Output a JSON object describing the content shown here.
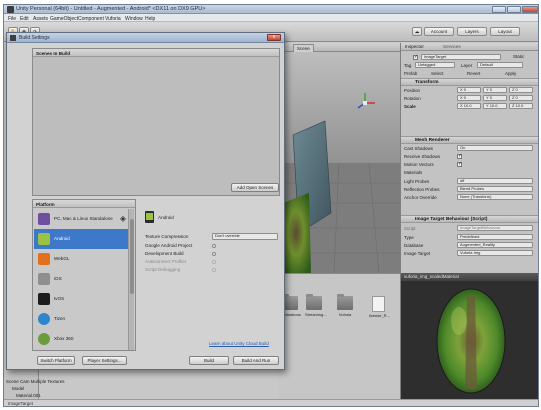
{
  "window": {
    "title": "Unity Personal (64bit) - Untitled - Augmented - Android* <DX11 on DX9 GPU>"
  },
  "menubar": [
    "File",
    "Edit",
    "Assets",
    "GameObject",
    "Component",
    "Vuforia",
    "Window",
    "Help"
  ],
  "toolbar": {
    "account_label": "Account",
    "layers_label": "Layers",
    "layout_label": "Layout"
  },
  "scene": {
    "tab_label": "Scene"
  },
  "inspector": {
    "tab_label": "Inspector",
    "services_label": "Services",
    "object_name": "ImageTarget",
    "static_label": "Static",
    "tag_label": "Tag",
    "tag_value": "Untagged",
    "layer_label": "Layer",
    "layer_value": "Default",
    "prefab_label": "Prefab",
    "select_label": "Select",
    "revert_label": "Revert",
    "apply_label": "Apply",
    "transform_title": "Transform",
    "position_label": "Position",
    "rotation_label": "Rotation",
    "scale_label": "Scale",
    "position_x": "X 0",
    "position_y": "Y 0",
    "position_z": "Z 0",
    "rotation_x": "X 0",
    "rotation_y": "Y 0",
    "rotation_z": "Z 0",
    "scale_x": "X 10.0",
    "scale_y": "Y 10.0",
    "scale_z": "Z 10.0",
    "mesh_renderer_title": "Mesh Renderer",
    "cast_shadows_label": "Cast Shadows",
    "cast_shadows_value": "On",
    "receive_shadows_label": "Receive Shadows",
    "motion_vectors_label": "Motion Vectors",
    "materials_label": "Materials",
    "light_probes_label": "Light Probes",
    "light_probes_value": "off",
    "reflection_probes_label": "Reflection Probes",
    "reflection_probes_value": "Blend Probes",
    "anchor_override_label": "Anchor Override",
    "anchor_override_value": "None (Transform)",
    "itb_title": "Image Target Behaviour (Script)",
    "script_label": "Script",
    "script_value": "ImageTargetBehaviour",
    "type_label": "Type",
    "type_value": "Predefined",
    "database_label": "Database",
    "database_value": "Augmented_Reality",
    "image_target_label": "Image Target",
    "image_target_value": "Vuforia Img"
  },
  "project": {
    "assets": [
      {
        "name": "Animations",
        "kind": "folder"
      },
      {
        "name": "Streaming...",
        "kind": "folder"
      },
      {
        "name": "Vuforia",
        "kind": "folder"
      },
      {
        "name": "license_R...",
        "kind": "document"
      }
    ]
  },
  "preview": {
    "title": "vuforia_img_scaledMaterial"
  },
  "hierarchy": {
    "rows": [
      "Scene Cam Multiple Textures",
      "Model",
      "Material.001"
    ]
  },
  "statusbar": {
    "text": "ImageTarget"
  },
  "build_settings": {
    "title": "Build Settings",
    "close_glyph": "x",
    "scenes_header": "Scenes In Build",
    "add_open_scenes_label": "Add Open Scenes",
    "platform_header": "Platform",
    "platforms": [
      {
        "label": "PC, Mac & Linux Standalone",
        "color": "#6e4fa0",
        "selected": false
      },
      {
        "label": "Android",
        "color": "#9bc243",
        "selected": true
      },
      {
        "label": "WebGL",
        "color": "#e3701f",
        "selected": false
      },
      {
        "label": "iOS",
        "color": "#8f8f8f",
        "selected": false
      },
      {
        "label": "tvOS",
        "color": "#1c1c1c",
        "selected": false
      },
      {
        "label": "Tizen",
        "color": "#2f86cc",
        "selected": false
      },
      {
        "label": "Xbox 360",
        "color": "#6b9e3a",
        "selected": false
      }
    ],
    "selected_platform_title": "Android",
    "texture_compression_label": "Texture Compression",
    "texture_compression_value": "Don't override",
    "google_android_project_label": "Google Android Project",
    "development_build_label": "Development Build",
    "autoconnect_profiler_label": "Autoconnect Profiler",
    "script_debugging_label": "Script Debugging",
    "learn_link": "Learn about Unity Cloud Build",
    "switch_platform_label": "Switch Platform",
    "player_settings_label": "Player Settings...",
    "build_label": "Build",
    "build_and_run_label": "Build And Run"
  },
  "colors": {
    "selection_blue": "#3d78c9",
    "link_blue": "#2a5db0"
  }
}
